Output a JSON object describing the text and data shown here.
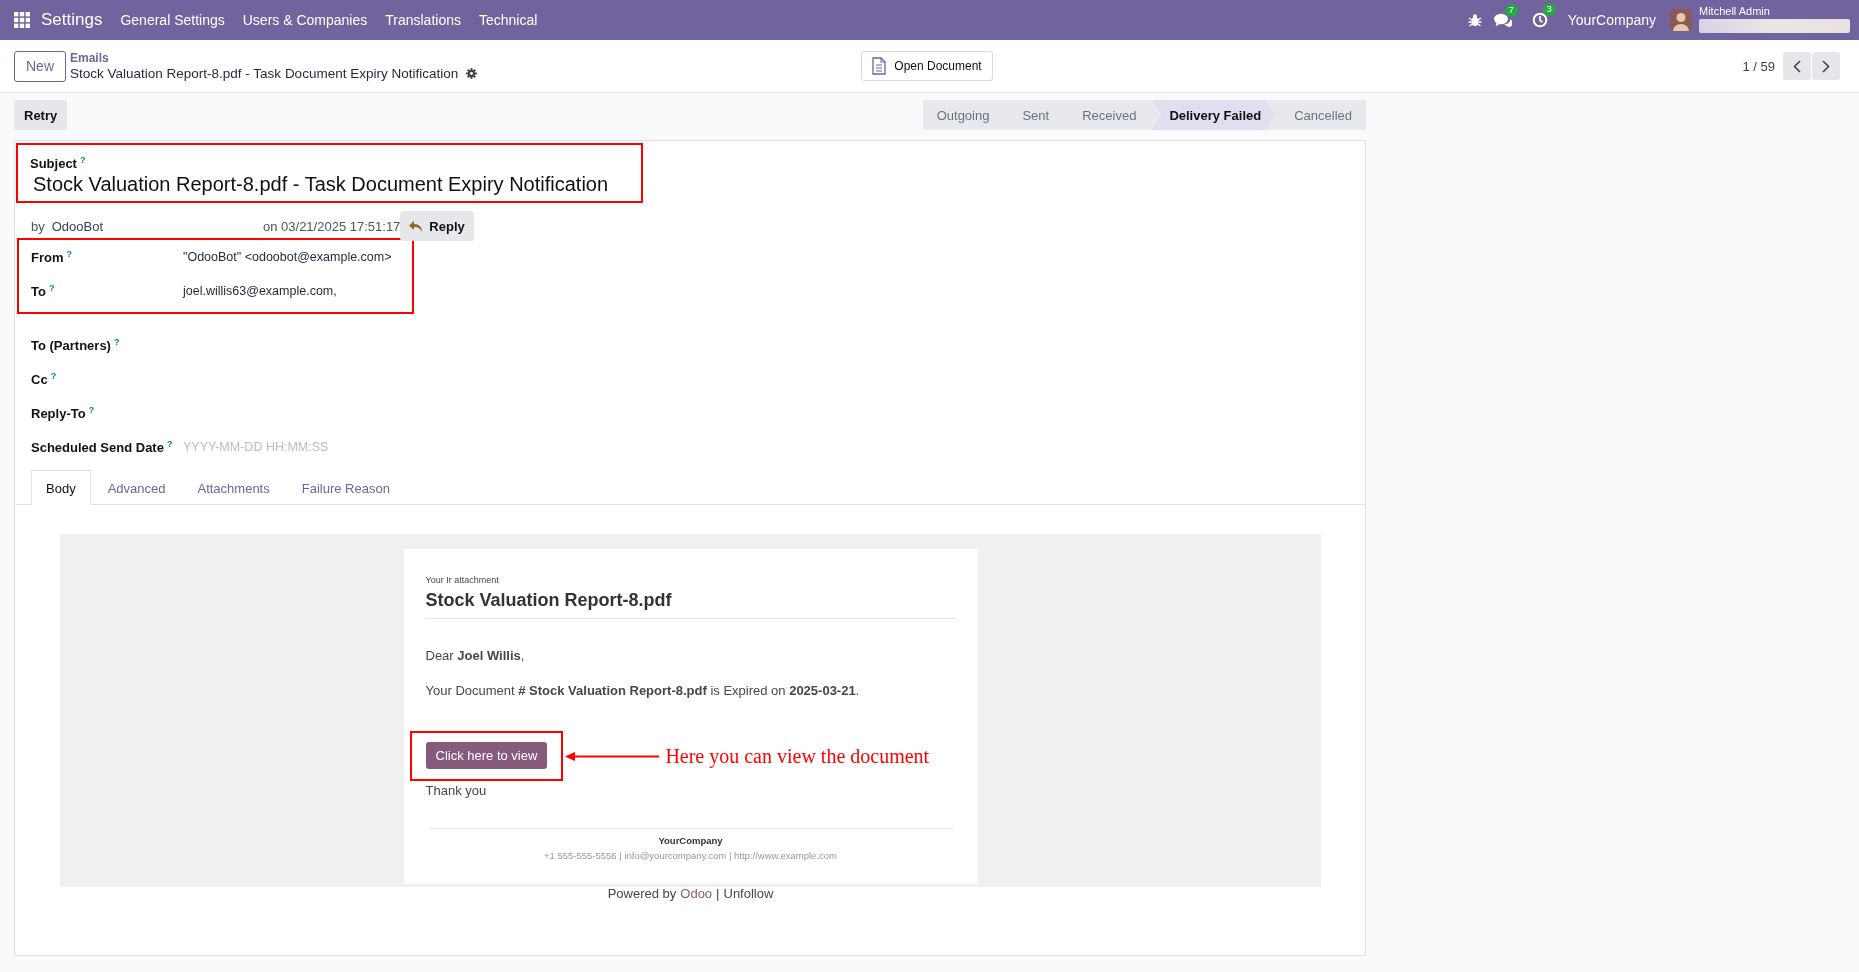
{
  "navbar": {
    "app": "Settings",
    "menu": [
      "General Settings",
      "Users & Companies",
      "Translations",
      "Technical"
    ],
    "messages_count": "7",
    "activities_count": "3",
    "company": "YourCompany",
    "user": "Mitchell Admin"
  },
  "control_panel": {
    "new_button": "New",
    "breadcrumb": "Emails",
    "title": "Stock Valuation Report-8.pdf - Task Document Expiry Notification",
    "open_document": "Open Document",
    "pager": "1 / 59"
  },
  "actions": [
    "Retry"
  ],
  "statusbar": [
    {
      "label": "Outgoing",
      "selected": false
    },
    {
      "label": "Sent",
      "selected": false
    },
    {
      "label": "Received",
      "selected": false
    },
    {
      "label": "Delivery Failed",
      "selected": true
    },
    {
      "label": "Cancelled",
      "selected": false
    }
  ],
  "subject": {
    "label": "Subject",
    "help": "?",
    "value": "Stock Valuation Report-8.pdf - Task Document Expiry Notification",
    "highlighted": true
  },
  "meta": {
    "by": "by",
    "author": "OdooBot",
    "date": "on 03/21/2025 17:51:17",
    "reply": "Reply"
  },
  "address_group": {
    "highlighted": true,
    "fields": [
      {
        "label": "From",
        "help": "?",
        "value": "\"OdooBot\" <odoobot@example.com>"
      },
      {
        "label": "To",
        "help": "?",
        "value": "joel.willis63@example.com,"
      }
    ]
  },
  "fields": [
    {
      "label": "To (Partners)",
      "help": "?"
    },
    {
      "label": "Cc",
      "help": "?"
    },
    {
      "label": "Reply-To",
      "help": "?"
    },
    {
      "label": "Scheduled Send Date",
      "help": "?",
      "placeholder": "YYYY-MM-DD HH:MM:SS"
    }
  ],
  "tabs": [
    {
      "label": "Body",
      "selected": true
    },
    {
      "label": "Advanced",
      "selected": false
    },
    {
      "label": "Attachments",
      "selected": false
    },
    {
      "label": "Failure Reason",
      "selected": false
    }
  ],
  "email": {
    "kicker": "Your Ir attachment",
    "title": "Stock Valuation Report-8.pdf",
    "greeting": "Dear **Joel Willis**,",
    "message": "Your Document **# Stock Valuation Report-8.pdf** is Expired on **2025-03-21**.",
    "button": {
      "label": "Click here to view",
      "highlighted": true
    },
    "closing": "Thank you",
    "company": "YourCompany",
    "contact": "+1 555-555-5556 | info@yourcompany.com | http://www.example.com",
    "powered_by": "Powered by",
    "powered_link": "Odoo",
    "separator": "|",
    "unfollow": "Unfollow"
  },
  "callout": {
    "text": "Here you can view the document"
  }
}
